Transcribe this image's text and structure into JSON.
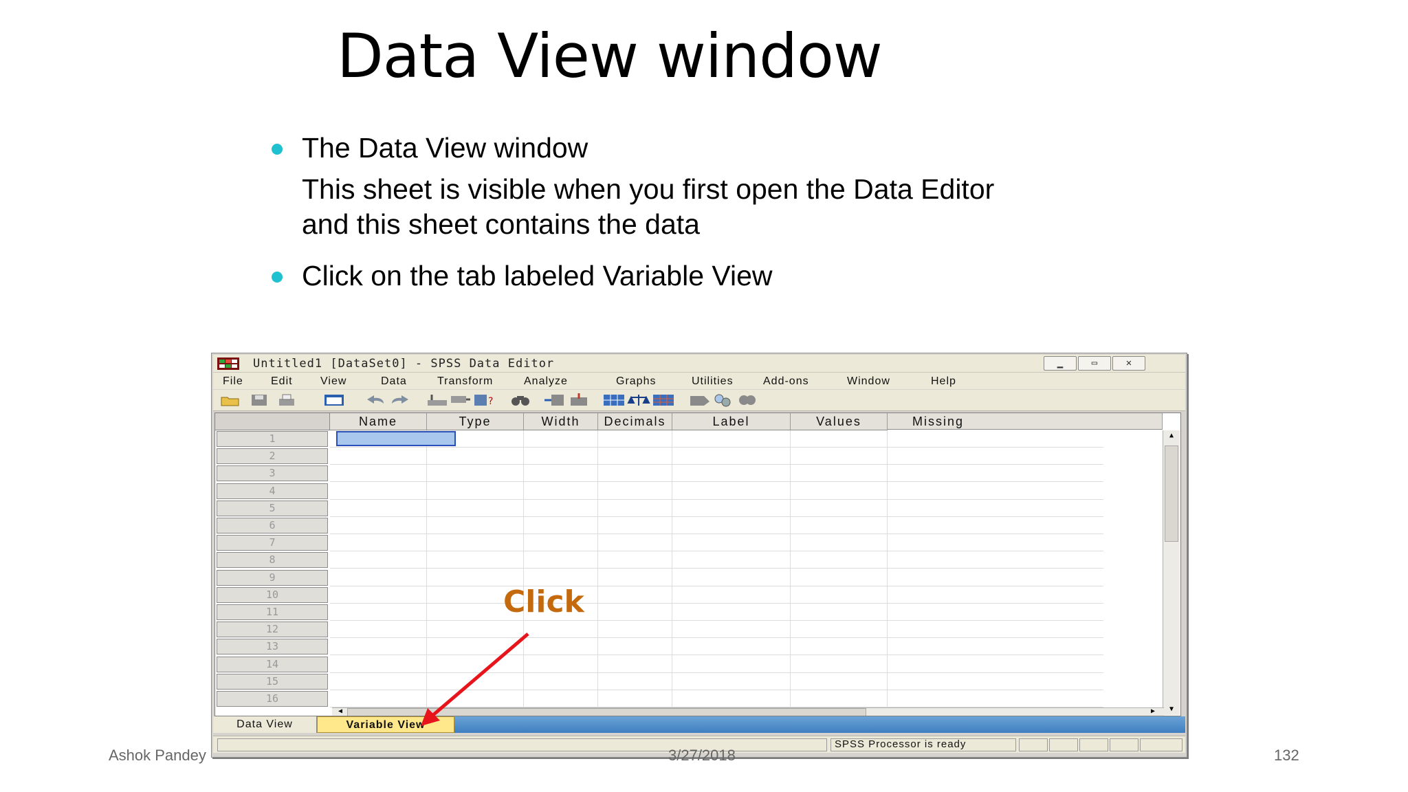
{
  "slide": {
    "title": "Data View window",
    "bullet1": "The Data View window",
    "bullet1_line1": "This sheet is visible when you first open the Data Editor",
    "bullet1_line2": "and this sheet contains the data",
    "bullet2": "Click on the tab labeled Variable View",
    "annotation": "Click",
    "footer_left": "Ashok Pandey",
    "footer_center": "3/27/2018",
    "footer_right": "132"
  },
  "window": {
    "title": "Untitled1 [DataSet0] - SPSS Data Editor",
    "menu": [
      "File",
      "Edit",
      "View",
      "Data",
      "Transform",
      "Analyze",
      "Graphs",
      "Utilities",
      "Add-ons",
      "Window",
      "Help"
    ],
    "columns": [
      "Name",
      "Type",
      "Width",
      "Decimals",
      "Label",
      "Values",
      "Missing"
    ],
    "rows": [
      "1",
      "2",
      "3",
      "4",
      "5",
      "6",
      "7",
      "8",
      "9",
      "10",
      "11",
      "12",
      "13",
      "14",
      "15",
      "16"
    ],
    "tabs": {
      "data_view": "Data View",
      "variable_view": "Variable View"
    },
    "status": "SPSS  Processor is ready"
  },
  "colors": {
    "bullet": "#1fc0d0",
    "annotation": "#c46a0c",
    "arrow": "#e8141c",
    "active_tab": "#ffe88c"
  }
}
